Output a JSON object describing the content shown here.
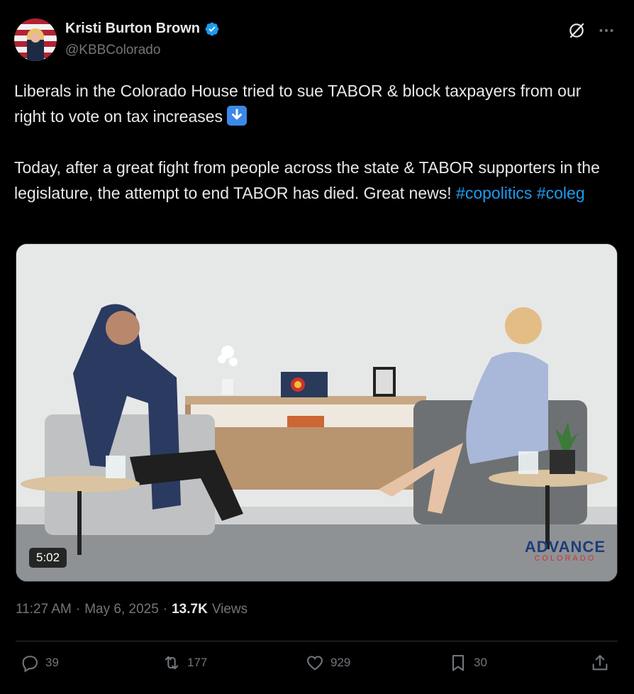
{
  "author": {
    "display_name": "Kristi Burton Brown",
    "handle": "@KBBColorado",
    "verified_icon": "verified-badge-icon"
  },
  "tweet": {
    "paragraph1": "Liberals in the Colorado House tried to sue TABOR & block taxpayers from our right to vote on tax increases",
    "paragraph2": "Today, after a great fight from people across the state & TABOR supporters in the legislature, the attempt to end TABOR has died. Great news!",
    "hashtags": [
      "#copolitics",
      "#coleg"
    ]
  },
  "media": {
    "duration": "5:02",
    "logo_top": "ADVANCE",
    "logo_bottom": "COLORADO"
  },
  "meta": {
    "time": "11:27 AM",
    "date": "May 6, 2025",
    "views_count": "13.7K",
    "views_label": "Views"
  },
  "actions": {
    "replies": "39",
    "reposts": "177",
    "likes": "929",
    "bookmarks": "30"
  },
  "colors": {
    "background": "#000000",
    "text": "#e7e9ea",
    "muted": "#71767b",
    "link": "#1d9bf0"
  }
}
